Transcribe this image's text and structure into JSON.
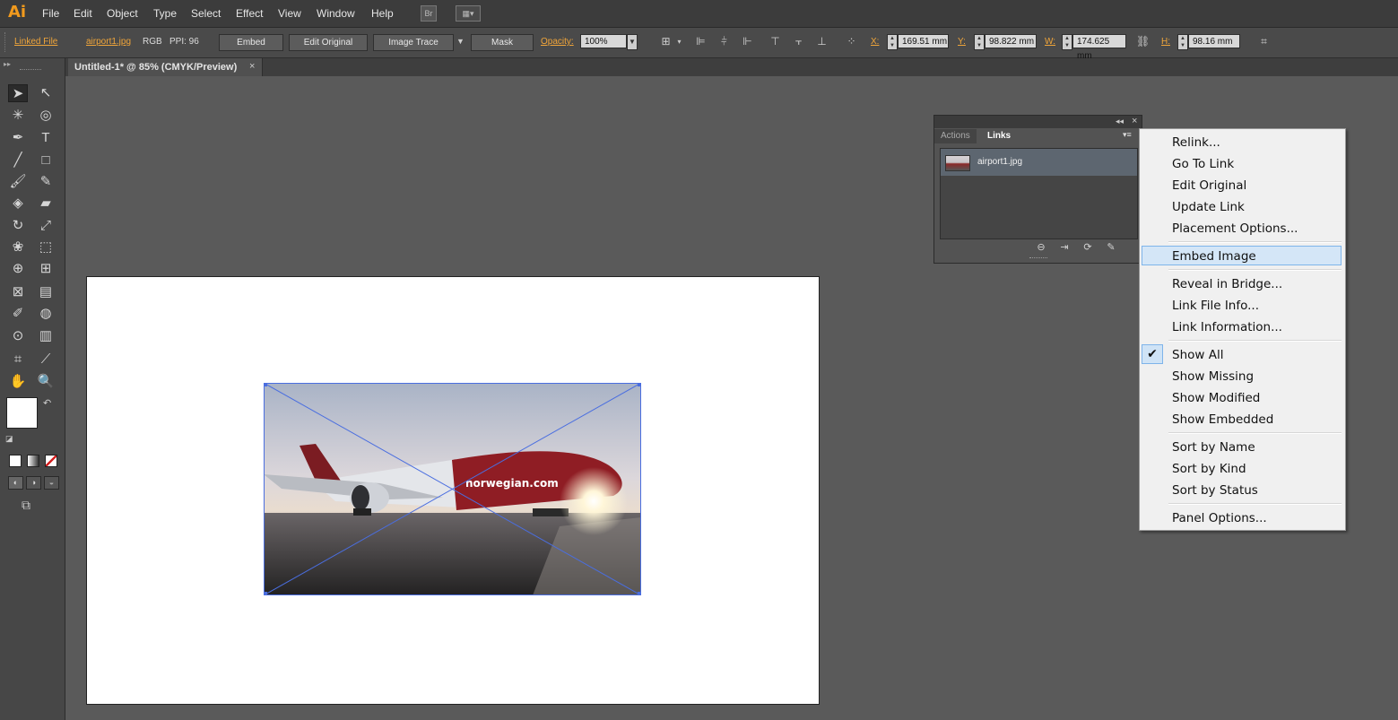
{
  "app": {
    "logo": "Ai"
  },
  "menubar": {
    "items": [
      "File",
      "Edit",
      "Object",
      "Type",
      "Select",
      "Effect",
      "View",
      "Window",
      "Help"
    ],
    "bridge_label": "Br"
  },
  "control_bar": {
    "linked_file_label": "Linked File",
    "file_name": "airport1.jpg",
    "color_mode": "RGB",
    "ppi": "PPI: 96",
    "embed_label": "Embed",
    "edit_original_label": "Edit Original",
    "image_trace_label": "Image Trace",
    "mask_label": "Mask",
    "opacity_label": "Opacity:",
    "opacity_value": "100%",
    "x_label": "X:",
    "x_value": "169.51 mm",
    "y_label": "Y:",
    "y_value": "98.822 mm",
    "w_label": "W:",
    "w_value": "174.625 mm",
    "h_label": "H:",
    "h_value": "98.16 mm"
  },
  "document": {
    "tab_title": "Untitled-1* @ 85% (CMYK/Preview)",
    "close_glyph": "×",
    "image_text": "norwegian.com"
  },
  "links_panel": {
    "tabs": [
      "Actions",
      "Links"
    ],
    "active_tab": "Links",
    "items": [
      {
        "name": "airport1.jpg"
      }
    ]
  },
  "context_menu": {
    "groups": [
      [
        "Relink...",
        "Go To Link",
        "Edit Original",
        "Update Link",
        "Placement Options..."
      ],
      [
        "Embed Image"
      ],
      [
        "Reveal in Bridge...",
        "Link File Info...",
        "Link Information..."
      ],
      [
        "Show All",
        "Show Missing",
        "Show Modified",
        "Show Embedded"
      ],
      [
        "Sort by Name",
        "Sort by Kind",
        "Sort by Status"
      ],
      [
        "Panel Options..."
      ]
    ],
    "highlighted": "Embed Image",
    "checked": "Show All"
  },
  "colors": {
    "accent": "#f0a53a",
    "logo": "#f19a1d",
    "selection": "#4a6ee0",
    "menu_highlight": "#d4e6f7"
  }
}
